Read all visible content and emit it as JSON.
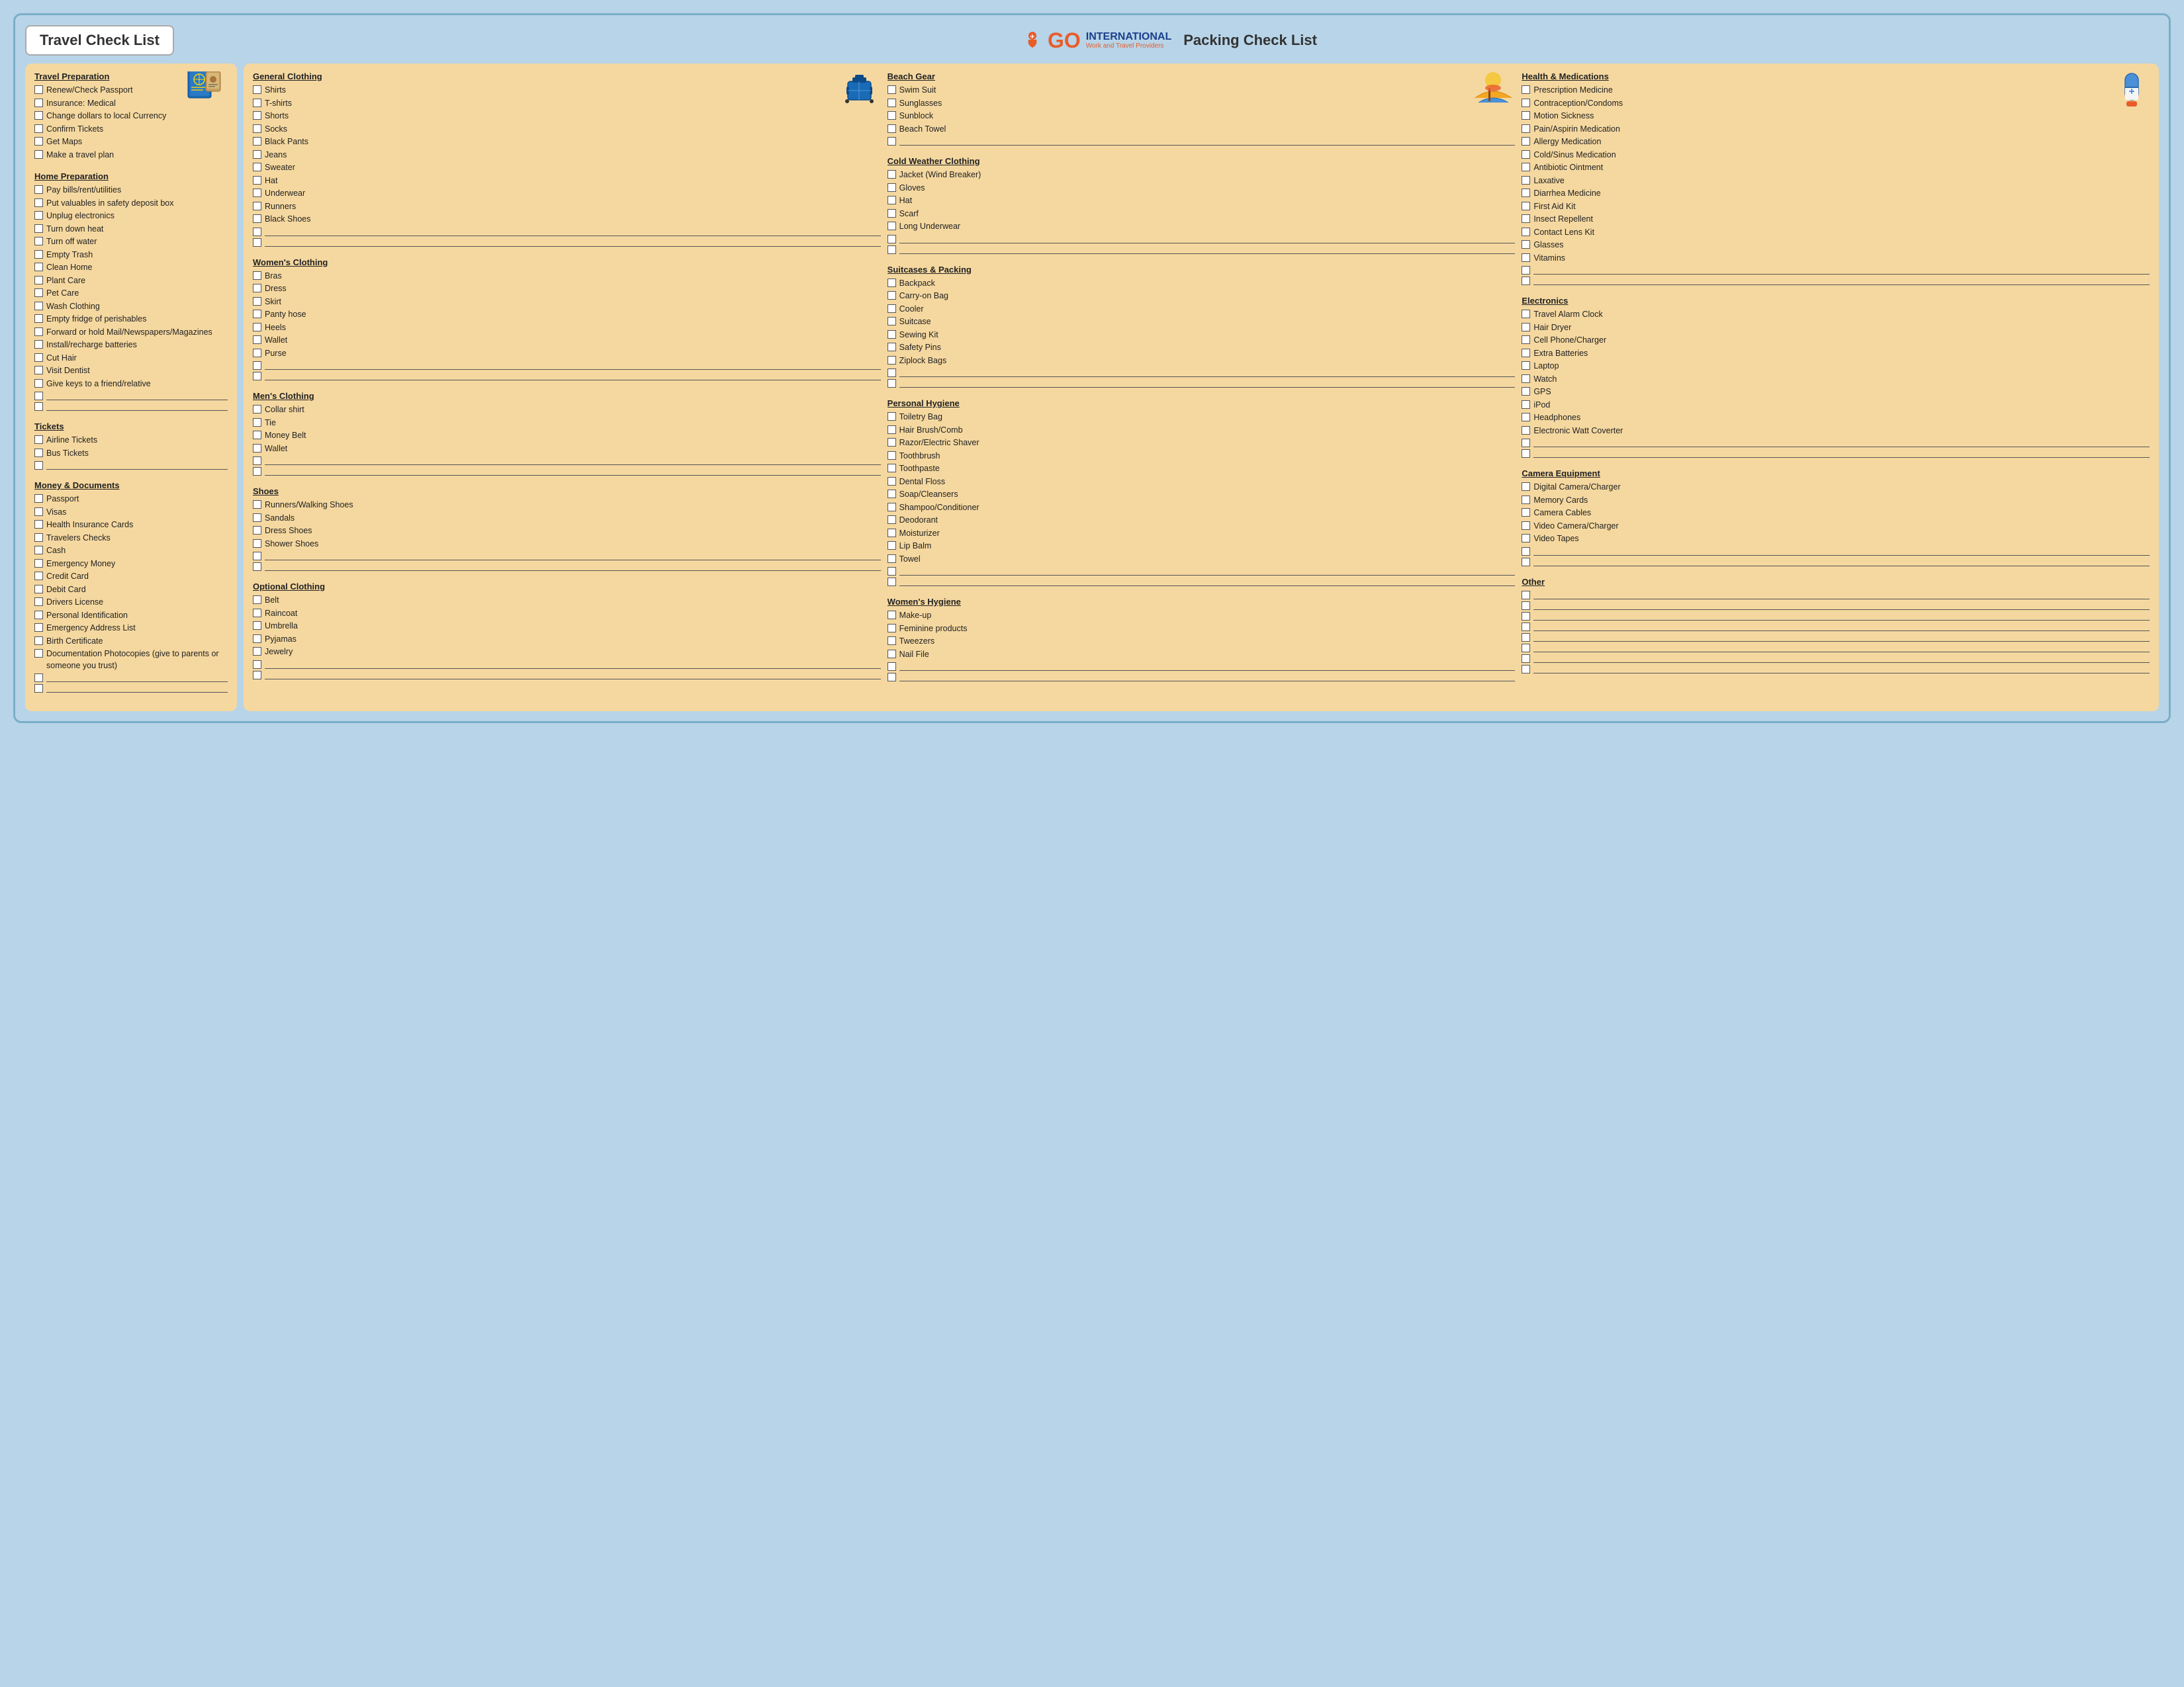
{
  "header": {
    "travel_title": "Travel Check List",
    "packing_title": "Packing Check List",
    "logo_go": "GO",
    "logo_international": "INTERNATIONAL",
    "logo_sub": "Work and Travel Providers"
  },
  "left_panel": {
    "sections": [
      {
        "id": "travel-preparation",
        "title": "Travel Preparation",
        "items": [
          "Renew/Check Passport",
          "Insurance: Medical",
          "Change dollars to local Currency",
          "Confirm Tickets",
          "Get Maps",
          "Make a travel plan"
        ],
        "blanks": 0
      },
      {
        "id": "home-preparation",
        "title": "Home Preparation",
        "items": [
          "Pay bills/rent/utilities",
          "Put valuables in safety deposit box",
          "Unplug electronics",
          "Turn down heat",
          "Turn off water",
          "Empty Trash",
          "Clean Home",
          "Plant Care",
          "Pet Care",
          "Wash Clothing",
          "Empty fridge of perishables",
          "Forward or hold Mail/Newspapers/Magazines",
          "Install/recharge batteries",
          "Cut Hair",
          "Visit Dentist",
          "Give keys to a friend/relative"
        ],
        "blanks": 2
      },
      {
        "id": "tickets",
        "title": "Tickets",
        "items": [
          "Airline Tickets",
          "Bus Tickets"
        ],
        "blanks": 1
      },
      {
        "id": "money-documents",
        "title": "Money & Documents",
        "items": [
          "Passport",
          "Visas",
          "Health Insurance Cards",
          "Travelers Checks",
          "Cash",
          "Emergency Money",
          "Credit Card",
          "Debit Card",
          "Drivers License",
          "Personal Identification",
          "Emergency Address List",
          "Birth Certificate",
          "Documentation Photocopies (give to parents or someone you trust)"
        ],
        "blanks": 2
      }
    ]
  },
  "right_panel": {
    "col1": {
      "sections": [
        {
          "id": "general-clothing",
          "title": "General Clothing",
          "items": [
            "Shirts",
            "T-shirts",
            "Shorts",
            "Socks",
            "Black Pants",
            "Jeans",
            "Sweater",
            "Hat",
            "Underwear",
            "Runners",
            "Black Shoes"
          ],
          "blanks": 2,
          "has_image": "luggage"
        },
        {
          "id": "womens-clothing",
          "title": "Women's Clothing",
          "items": [
            "Bras",
            "Dress",
            "Skirt",
            "Panty hose",
            "Heels",
            "Wallet",
            "Purse"
          ],
          "blanks": 2
        },
        {
          "id": "mens-clothing",
          "title": "Men's Clothing",
          "items": [
            "Collar shirt",
            "Tie",
            "Money Belt",
            "Wallet"
          ],
          "blanks": 2
        },
        {
          "id": "shoes",
          "title": "Shoes",
          "items": [
            "Runners/Walking Shoes",
            "Sandals",
            "Dress Shoes",
            "Shower Shoes"
          ],
          "blanks": 2
        },
        {
          "id": "optional-clothing",
          "title": "Optional Clothing",
          "items": [
            "Belt",
            "Raincoat",
            "Umbrella",
            "Pyjamas",
            "Jewelry"
          ],
          "blanks": 2
        }
      ]
    },
    "col2": {
      "sections": [
        {
          "id": "beach-gear",
          "title": "Beach Gear",
          "items": [
            "Swim Suit",
            "Sunglasses",
            "Sunblock",
            "Beach Towel"
          ],
          "blanks": 1,
          "has_image": "beach"
        },
        {
          "id": "cold-weather",
          "title": "Cold Weather Clothing",
          "items": [
            "Jacket (Wind Breaker)",
            "Gloves",
            "Hat",
            "Scarf",
            "Long Underwear"
          ],
          "blanks": 2
        },
        {
          "id": "suitcases-packing",
          "title": "Suitcases & Packing",
          "items": [
            "Backpack",
            "Carry-on Bag",
            "Cooler",
            "Suitcase",
            "Sewing Kit",
            "Safety Pins",
            "Ziplock Bags"
          ],
          "blanks": 2
        },
        {
          "id": "personal-hygiene",
          "title": "Personal Hygiene",
          "items": [
            "Toiletry Bag",
            "Hair Brush/Comb",
            "Razor/Electric Shaver",
            "Toothbrush",
            "Toothpaste",
            "Dental Floss",
            "Soap/Cleansers",
            "Shampoo/Conditioner",
            "Deodorant",
            "Moisturizer",
            "Lip Balm",
            "Towel"
          ],
          "blanks": 2
        },
        {
          "id": "womens-hygiene",
          "title": "Women's Hygiene",
          "items": [
            "Make-up",
            "Feminine products",
            "Tweezers",
            "Nail File"
          ],
          "blanks": 2
        }
      ]
    },
    "col3": {
      "sections": [
        {
          "id": "health-medications",
          "title": "Health & Medications",
          "items": [
            "Prescription Medicine",
            "Contraception/Condoms",
            "Motion Sickness",
            "Pain/Aspirin Medication",
            "Allergy Medication",
            "Cold/Sinus Medication",
            "Antibiotic Ointment",
            "Laxative",
            "Diarrhea Medicine",
            "First Aid Kit",
            "Insect Repellent",
            "Contact Lens Kit",
            "Glasses",
            "Vitamins"
          ],
          "blanks": 2,
          "has_image": "medicine"
        },
        {
          "id": "electronics",
          "title": "Electronics",
          "items": [
            "Travel Alarm Clock",
            "Hair Dryer",
            "Cell Phone/Charger",
            "Extra Batteries",
            "Laptop",
            "Watch",
            "GPS",
            "iPod",
            "Headphones",
            "Electronic Watt Coverter"
          ],
          "blanks": 2
        },
        {
          "id": "camera-equipment",
          "title": "Camera Equipment",
          "items": [
            "Digital Camera/Charger",
            "Memory Cards",
            "Camera Cables",
            "Video Camera/Charger",
            "Video Tapes"
          ],
          "blanks": 2
        },
        {
          "id": "other",
          "title": "Other",
          "items": [],
          "blanks": 8
        }
      ]
    }
  }
}
